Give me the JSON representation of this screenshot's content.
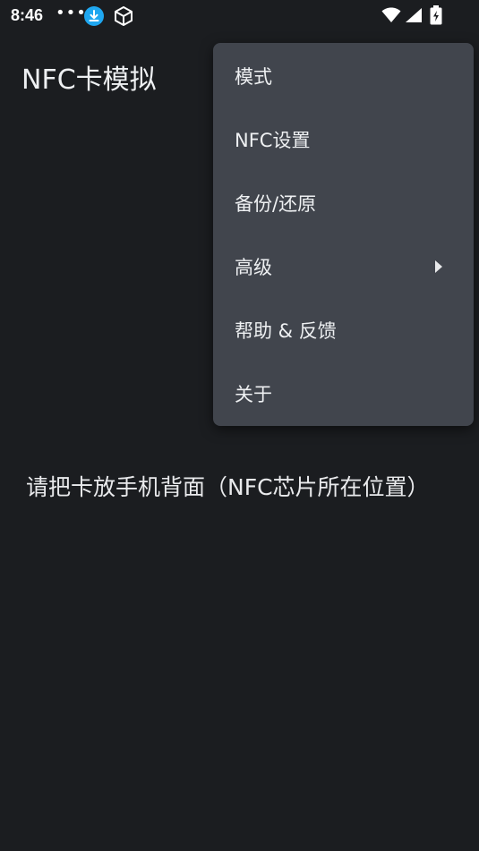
{
  "status_bar": {
    "time": "8:46",
    "more": "•••",
    "download_icon_color": "#1fa7f0",
    "icons": [
      "download-icon",
      "box-icon",
      "wifi-icon",
      "signal-icon",
      "battery-charging-icon"
    ]
  },
  "app_bar": {
    "title": "NFC卡模拟"
  },
  "main": {
    "instruction": "请把卡放手机背面（NFC芯片所在位置）"
  },
  "overflow_menu": {
    "items": [
      {
        "label": "模式"
      },
      {
        "label": "NFC设置"
      },
      {
        "label": "备份/还原"
      },
      {
        "label": "高级",
        "has_submenu": true
      },
      {
        "label": "帮助 & 反馈"
      },
      {
        "label": "关于"
      }
    ]
  },
  "colors": {
    "background": "#1b1d20",
    "menu_background": "#41454d",
    "text": "#eef0f2"
  }
}
